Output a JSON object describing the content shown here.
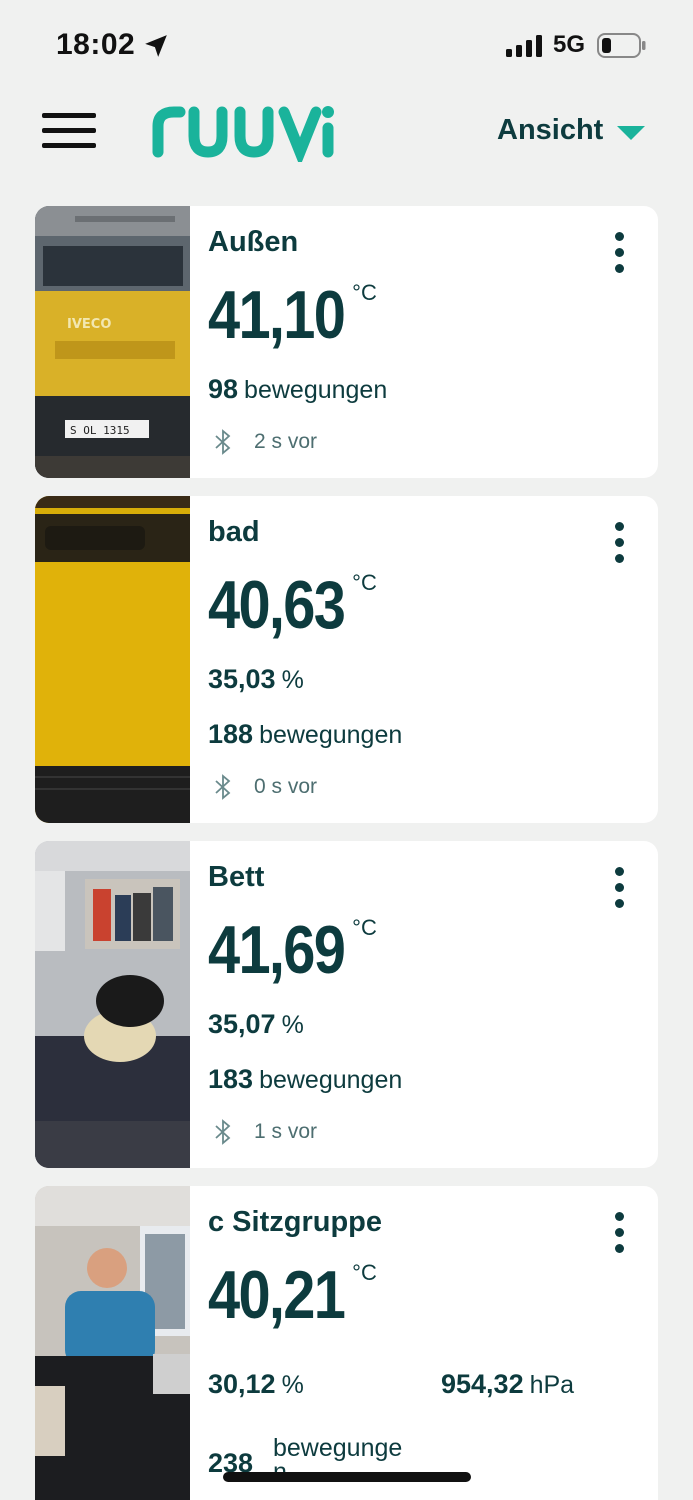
{
  "status_bar": {
    "time": "18:02",
    "network": "5G"
  },
  "header": {
    "logo_text": "ruuvi",
    "view_label": "Ansicht",
    "brand_color": "#1ab39b"
  },
  "icons": {
    "menu": "hamburger-icon",
    "more": "more-vertical-icon",
    "bluetooth": "bluetooth-icon",
    "dropdown": "caret-down-icon"
  },
  "sensors": [
    {
      "name": "Außen",
      "temperature": "41,10",
      "temperature_unit": "°C",
      "movements_value": "98",
      "movements_label": "bewegungen",
      "updated": "2 s vor",
      "photo": "yellow IVECO van"
    },
    {
      "name": "bad",
      "temperature": "40,63",
      "temperature_unit": "°C",
      "humidity_value": "35,03",
      "humidity_unit": "%",
      "movements_value": "188",
      "movements_label": "bewegungen",
      "updated": "0 s vor",
      "photo": "yellow bathroom panel"
    },
    {
      "name": "Bett",
      "temperature": "41,69",
      "temperature_unit": "°C",
      "humidity_value": "35,07",
      "humidity_unit": "%",
      "movements_value": "183",
      "movements_label": "bewegungen",
      "updated": "1 s vor",
      "photo": "bed with plush toy"
    },
    {
      "name": "c Sitzgruppe",
      "temperature": "40,21",
      "temperature_unit": "°C",
      "humidity_value": "30,12",
      "humidity_unit": "%",
      "pressure_value": "954,32",
      "pressure_unit": "hPa",
      "movements_value": "238",
      "movements_label": "bewegunge n",
      "photo": "man seated at table"
    }
  ]
}
